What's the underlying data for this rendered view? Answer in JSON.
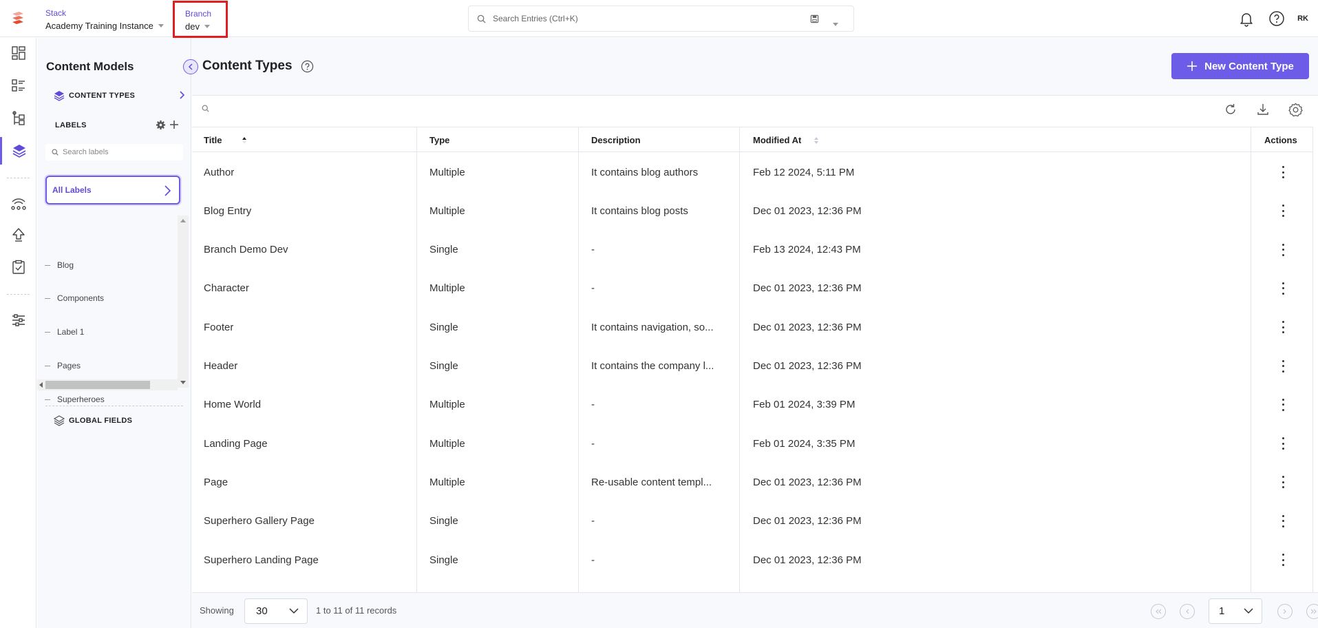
{
  "topbar": {
    "stack_label": "Stack",
    "stack_value": "Academy Training Instance",
    "branch_label": "Branch",
    "branch_value": "dev",
    "search_placeholder": "Search Entries (Ctrl+K)",
    "avatar_initials": "RK"
  },
  "panel": {
    "title": "Content Models",
    "content_types_link": "CONTENT TYPES",
    "labels_heading": "LABELS",
    "label_search_placeholder": "Search labels",
    "all_labels": "All Labels",
    "labels": [
      "Blog",
      "Components",
      "Label 1",
      "Pages",
      "Superheroes"
    ],
    "global_fields_link": "GLOBAL FIELDS"
  },
  "main": {
    "title": "Content Types",
    "new_button": "New Content Type",
    "columns": {
      "title": "Title",
      "type": "Type",
      "description": "Description",
      "modified_at": "Modified At",
      "actions": "Actions"
    },
    "rows": [
      {
        "title": "Author",
        "type": "Multiple",
        "description": "It contains blog authors",
        "modified": "Feb 12 2024, 5:11 PM"
      },
      {
        "title": "Blog Entry",
        "type": "Multiple",
        "description": "It contains blog posts",
        "modified": "Dec 01 2023, 12:36 PM"
      },
      {
        "title": "Branch Demo Dev",
        "type": "Single",
        "description": "-",
        "modified": "Feb 13 2024, 12:43 PM"
      },
      {
        "title": "Character",
        "type": "Multiple",
        "description": "-",
        "modified": "Dec 01 2023, 12:36 PM"
      },
      {
        "title": "Footer",
        "type": "Single",
        "description": "It contains navigation, so...",
        "modified": "Dec 01 2023, 12:36 PM"
      },
      {
        "title": "Header",
        "type": "Single",
        "description": "It contains the company l...",
        "modified": "Dec 01 2023, 12:36 PM"
      },
      {
        "title": "Home World",
        "type": "Multiple",
        "description": "-",
        "modified": "Feb 01 2024, 3:39 PM"
      },
      {
        "title": "Landing Page",
        "type": "Multiple",
        "description": "-",
        "modified": "Feb 01 2024, 3:35 PM"
      },
      {
        "title": "Page",
        "type": "Multiple",
        "description": "Re-usable content templ...",
        "modified": "Dec 01 2023, 12:36 PM"
      },
      {
        "title": "Superhero Gallery Page",
        "type": "Single",
        "description": "-",
        "modified": "Dec 01 2023, 12:36 PM"
      },
      {
        "title": "Superhero Landing Page",
        "type": "Single",
        "description": "-",
        "modified": "Dec 01 2023, 12:36 PM"
      }
    ]
  },
  "footer": {
    "showing_label": "Showing",
    "page_size": "30",
    "records_text": "1 to 11 of 11 records",
    "current_page": "1"
  },
  "colors": {
    "accent": "#6c5ce7",
    "highlight_border": "#e01e1e"
  }
}
